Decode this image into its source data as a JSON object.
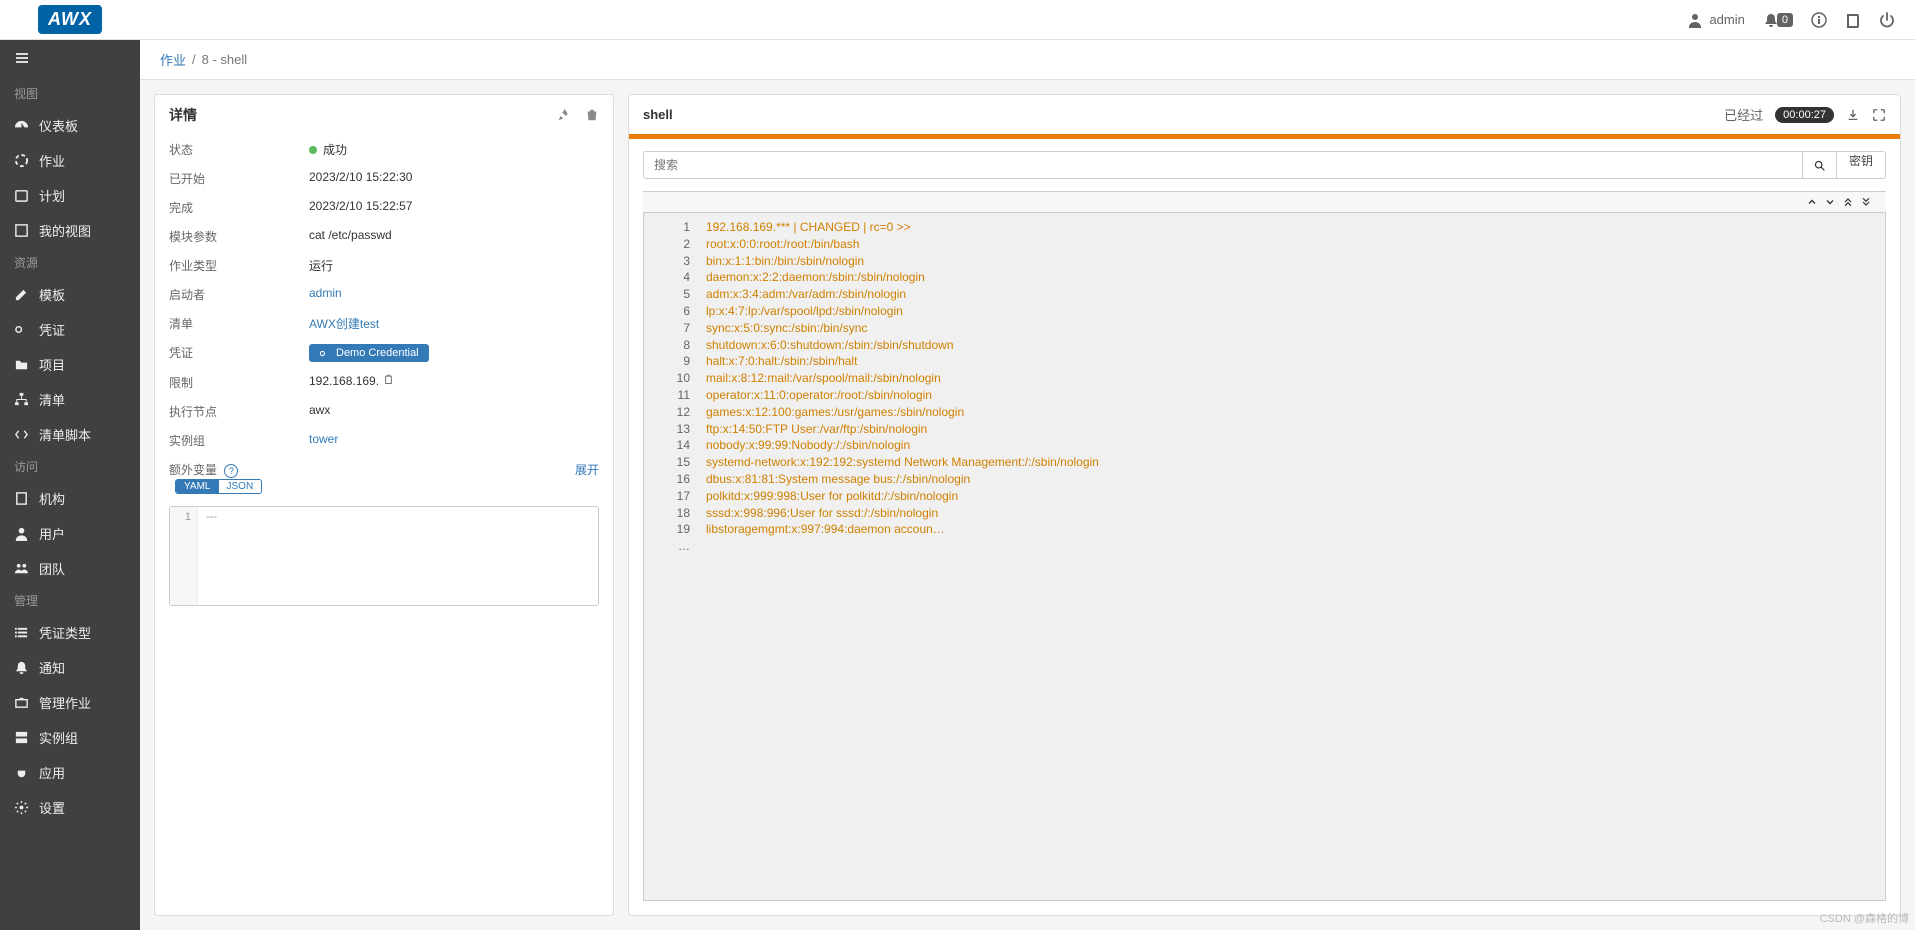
{
  "brand": "AWX",
  "top": {
    "username": "admin",
    "notif_count": "0"
  },
  "sidebar": {
    "sections": [
      {
        "label": "视图",
        "items": [
          {
            "key": "dashboard",
            "label": "仪表板",
            "icon": "gauge"
          },
          {
            "key": "jobs",
            "label": "作业",
            "icon": "spinner"
          },
          {
            "key": "schedules",
            "label": "计划",
            "icon": "calendar"
          },
          {
            "key": "myview",
            "label": "我的视图",
            "icon": "layout"
          }
        ]
      },
      {
        "label": "资源",
        "items": [
          {
            "key": "templates",
            "label": "模板",
            "icon": "pencil"
          },
          {
            "key": "credentials",
            "label": "凭证",
            "icon": "key"
          },
          {
            "key": "projects",
            "label": "项目",
            "icon": "folder"
          },
          {
            "key": "inventories",
            "label": "清单",
            "icon": "sitemap"
          },
          {
            "key": "inv-scripts",
            "label": "清单脚本",
            "icon": "code"
          }
        ]
      },
      {
        "label": "访问",
        "items": [
          {
            "key": "orgs",
            "label": "机构",
            "icon": "building"
          },
          {
            "key": "users",
            "label": "用户",
            "icon": "user"
          },
          {
            "key": "teams",
            "label": "团队",
            "icon": "users"
          }
        ]
      },
      {
        "label": "管理",
        "items": [
          {
            "key": "cred-types",
            "label": "凭证类型",
            "icon": "list"
          },
          {
            "key": "notifications",
            "label": "通知",
            "icon": "bell"
          },
          {
            "key": "mgmt-jobs",
            "label": "管理作业",
            "icon": "briefcase"
          },
          {
            "key": "instance-groups",
            "label": "实例组",
            "icon": "server"
          },
          {
            "key": "apps",
            "label": "应用",
            "icon": "plug"
          },
          {
            "key": "settings",
            "label": "设置",
            "icon": "cog"
          }
        ]
      }
    ]
  },
  "breadcrumb": {
    "root": "作业",
    "sep": "/",
    "current": "8 - shell"
  },
  "details": {
    "title": "详情",
    "rows": {
      "status_label": "状态",
      "status_value": "成功",
      "started_label": "已开始",
      "started_value": "2023/2/10 15:22:30",
      "finished_label": "完成",
      "finished_value": "2023/2/10 15:22:57",
      "module_label": "模块参数",
      "module_value": "cat /etc/passwd",
      "jobtype_label": "作业类型",
      "jobtype_value": "运行",
      "launchedby_label": "启动者",
      "launchedby_value": "admin",
      "inventory_label": "清单",
      "inventory_value": "AWX创建test",
      "credential_label": "凭证",
      "credential_value": "Demo Credential",
      "limit_label": "限制",
      "limit_value": "192.168.169.",
      "execnode_label": "执行节点",
      "execnode_value": "awx",
      "instgroup_label": "实例组",
      "instgroup_value": "tower",
      "extravars_label": "额外变量",
      "yaml": "YAML",
      "json": "JSON",
      "expand": "展开",
      "extravars_code": "---"
    }
  },
  "output": {
    "title": "shell",
    "elapsed_label": "已经过",
    "elapsed_value": "00:00:27",
    "search_placeholder": "搜索",
    "key_btn": "密钥",
    "lines": [
      "192.168.169.*** | CHANGED | rc=0 >>",
      "root:x:0:0:root:/root:/bin/bash",
      "bin:x:1:1:bin:/bin:/sbin/nologin",
      "daemon:x:2:2:daemon:/sbin:/sbin/nologin",
      "adm:x:3:4:adm:/var/adm:/sbin/nologin",
      "lp:x:4:7:lp:/var/spool/lpd:/sbin/nologin",
      "sync:x:5:0:sync:/sbin:/bin/sync",
      "shutdown:x:6:0:shutdown:/sbin:/sbin/shutdown",
      "halt:x:7:0:halt:/sbin:/sbin/halt",
      "mail:x:8:12:mail:/var/spool/mail:/sbin/nologin",
      "operator:x:11:0:operator:/root:/sbin/nologin",
      "games:x:12:100:games:/usr/games:/sbin/nologin",
      "ftp:x:14:50:FTP User:/var/ftp:/sbin/nologin",
      "nobody:x:99:99:Nobody:/:/sbin/nologin",
      "systemd-network:x:192:192:systemd Network Management:/:/sbin/nologin",
      "dbus:x:81:81:System message bus:/:/sbin/nologin",
      "polkitd:x:999:998:User for polkitd:/:/sbin/nologin",
      "sssd:x:998:996:User for sssd:/:/sbin/nologin",
      "libstoragemgmt:x:997:994:daemon accoun…"
    ]
  },
  "watermark": "CSDN @森格的博"
}
